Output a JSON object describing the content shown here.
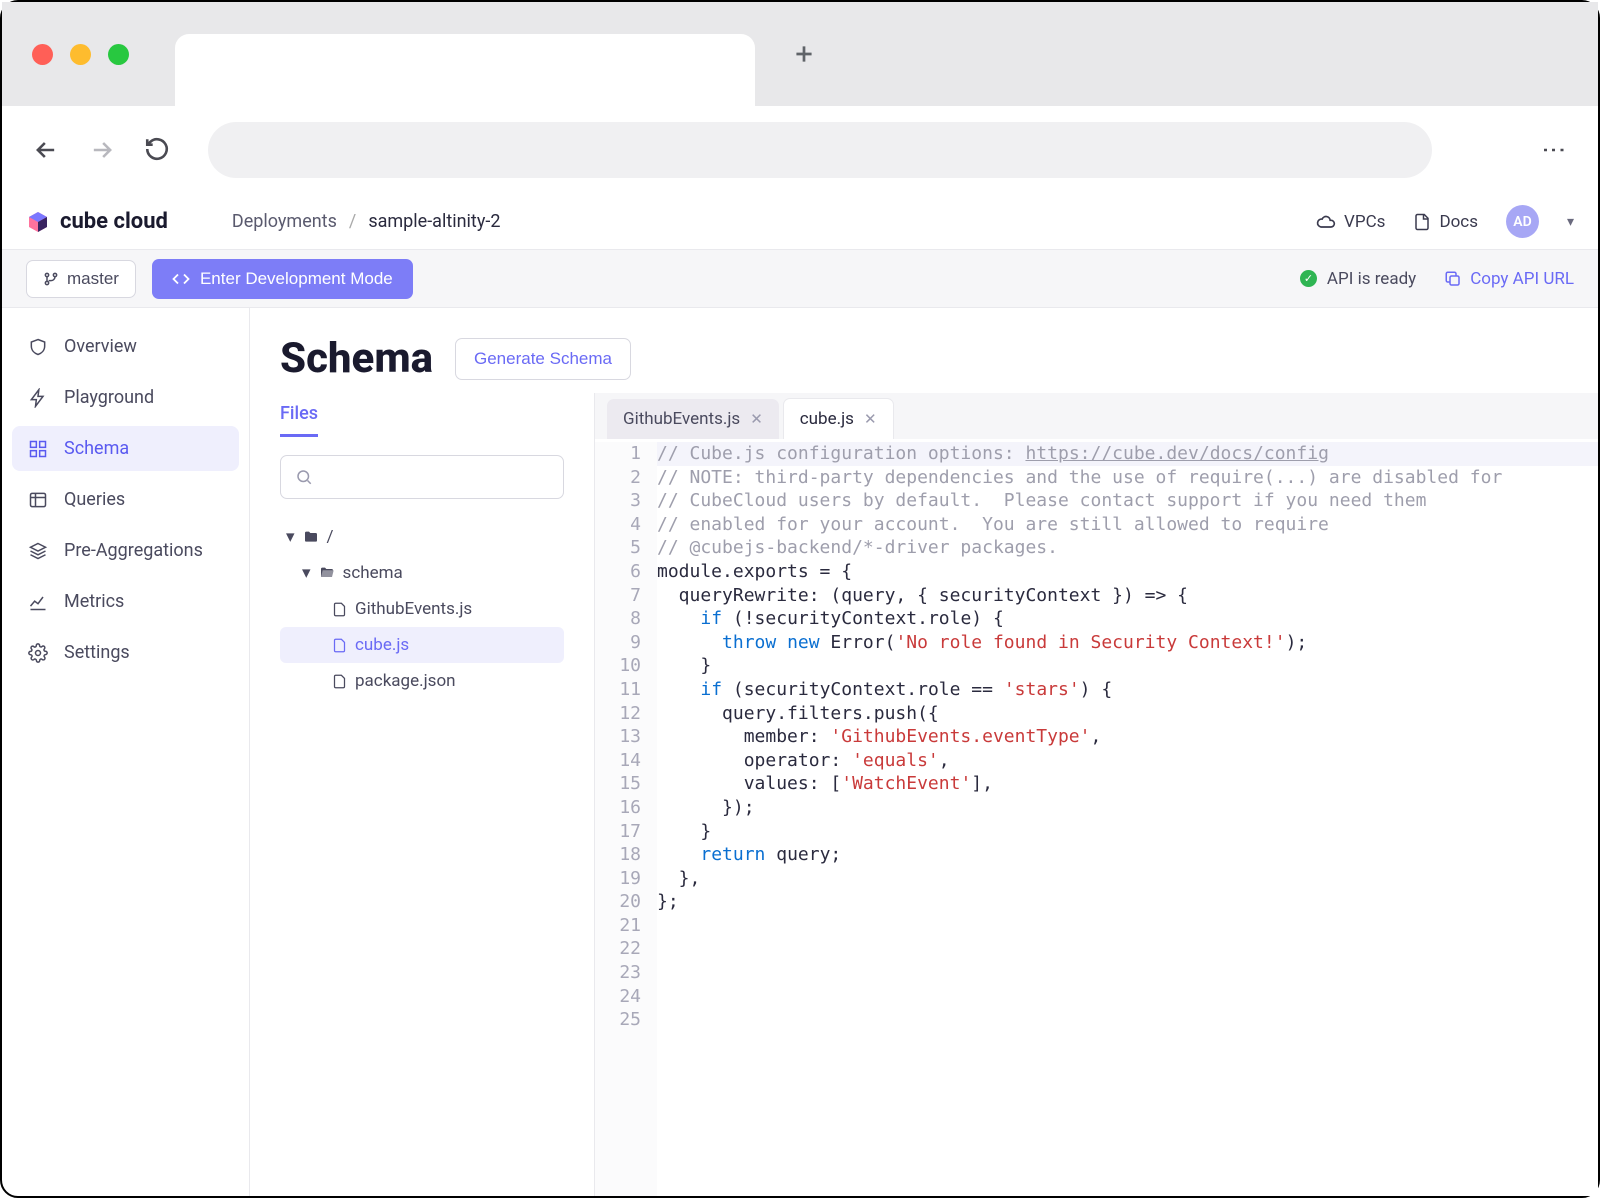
{
  "header": {
    "logo_text": "cube cloud",
    "breadcrumb": {
      "root": "Deployments",
      "current": "sample-altinity-2"
    },
    "links": {
      "vpcs": "VPCs",
      "docs": "Docs"
    },
    "avatar_initials": "AD"
  },
  "devbar": {
    "branch": "master",
    "dev_mode_btn": "Enter Development Mode",
    "api_status": "API is ready",
    "copy_api": "Copy API URL"
  },
  "sidebar": {
    "items": [
      {
        "label": "Overview"
      },
      {
        "label": "Playground"
      },
      {
        "label": "Schema"
      },
      {
        "label": "Queries"
      },
      {
        "label": "Pre-Aggregations"
      },
      {
        "label": "Metrics"
      },
      {
        "label": "Settings"
      }
    ]
  },
  "page": {
    "title": "Schema",
    "generate_btn": "Generate Schema"
  },
  "files": {
    "tab": "Files",
    "root": "/",
    "folder": "schema",
    "items": [
      "GithubEvents.js",
      "cube.js",
      "package.json"
    ],
    "active": "cube.js"
  },
  "editor": {
    "tabs": [
      {
        "name": "GithubEvents.js",
        "active": false
      },
      {
        "name": "cube.js",
        "active": true
      }
    ],
    "code": {
      "l1a": "// Cube.js configuration options: ",
      "l1b": "https://cube.dev/docs/config",
      "l2": "",
      "l3": "// NOTE: third-party dependencies and the use of require(...) are disabled for",
      "l4": "// CubeCloud users by default.  Please contact support if you need them",
      "l5": "// enabled for your account.  You are still allowed to require",
      "l6": "// @cubejs-backend/*-driver packages.",
      "l7": "",
      "l8a": "module.exports = {",
      "l9a": "  queryRewrite: (query, { securityContext }) => {",
      "l10a": "    ",
      "l10b": "if",
      "l10c": " (!securityContext.role) {",
      "l11a": "      ",
      "l11b": "throw",
      "l11c": " ",
      "l11d": "new",
      "l11e": " Error(",
      "l11f": "'No role found in Security Context!'",
      "l11g": ");",
      "l12": "    }",
      "l13": "",
      "l14a": "    ",
      "l14b": "if",
      "l14c": " (securityContext.role == ",
      "l14d": "'stars'",
      "l14e": ") {",
      "l15": "      query.filters.push({",
      "l16a": "        member: ",
      "l16b": "'GithubEvents.eventType'",
      "l16c": ",",
      "l17a": "        operator: ",
      "l17b": "'equals'",
      "l17c": ",",
      "l18a": "        values: [",
      "l18b": "'WatchEvent'",
      "l18c": "],",
      "l19": "      });",
      "l20": "    }",
      "l21": "",
      "l22a": "    ",
      "l22b": "return",
      "l22c": " query;",
      "l23": "  },",
      "l24": "};",
      "l25": ""
    }
  },
  "line_numbers": [
    "1",
    "2",
    "3",
    "4",
    "5",
    "6",
    "7",
    "8",
    "9",
    "10",
    "11",
    "12",
    "13",
    "14",
    "15",
    "16",
    "17",
    "18",
    "19",
    "20",
    "21",
    "22",
    "23",
    "24",
    "25"
  ]
}
